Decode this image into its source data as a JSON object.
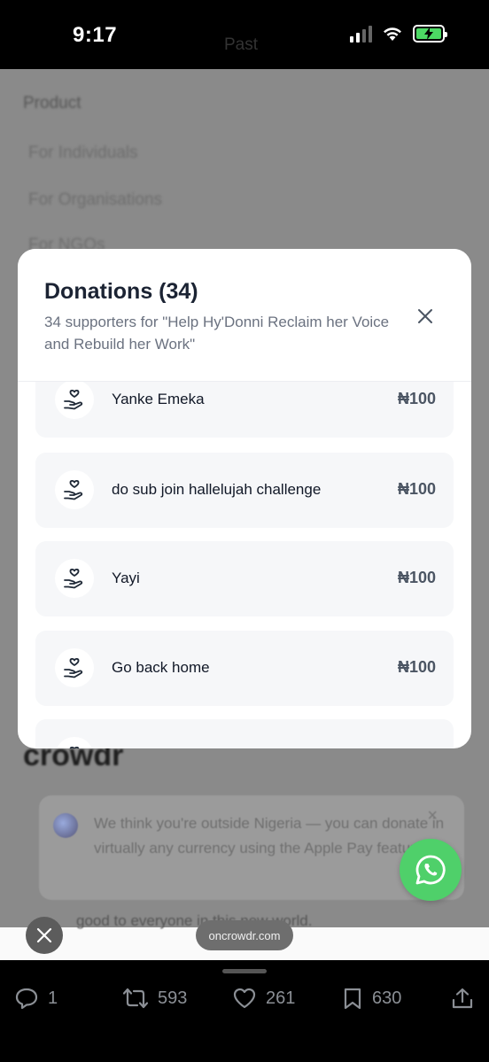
{
  "status_bar": {
    "time": "9:17"
  },
  "behind_page": {
    "header_title": "Past",
    "menu_heading": "Product",
    "menu_items": [
      "For Individuals",
      "For Organisations",
      "For NGOs"
    ],
    "brand": "crowdr",
    "notice": "We think you're outside Nigeria — you can donate in virtually any currency using the Apple Pay feature!",
    "bottom_text": "good to everyone in this new world."
  },
  "modal": {
    "title": "Donations (34)",
    "subtitle": "34 supporters for \"Help Hy'Donni Reclaim her Voice and Rebuild her Work\"",
    "donations": [
      {
        "name": "Yanke Emeka",
        "amount": "₦100"
      },
      {
        "name": "do sub join hallelujah challenge",
        "amount": "₦100"
      },
      {
        "name": "Yayi",
        "amount": "₦100"
      },
      {
        "name": "Go back home",
        "amount": "₦100"
      },
      {
        "name": "",
        "amount": ""
      }
    ]
  },
  "browser": {
    "url": "oncrowdr.com"
  },
  "actions": {
    "replies": "1",
    "reposts": "593",
    "likes": "261",
    "bookmarks": "630"
  },
  "colors": {
    "whatsapp": "#4fd06a",
    "modal_bg": "#ffffff",
    "card_bg": "#f6f7f9"
  }
}
